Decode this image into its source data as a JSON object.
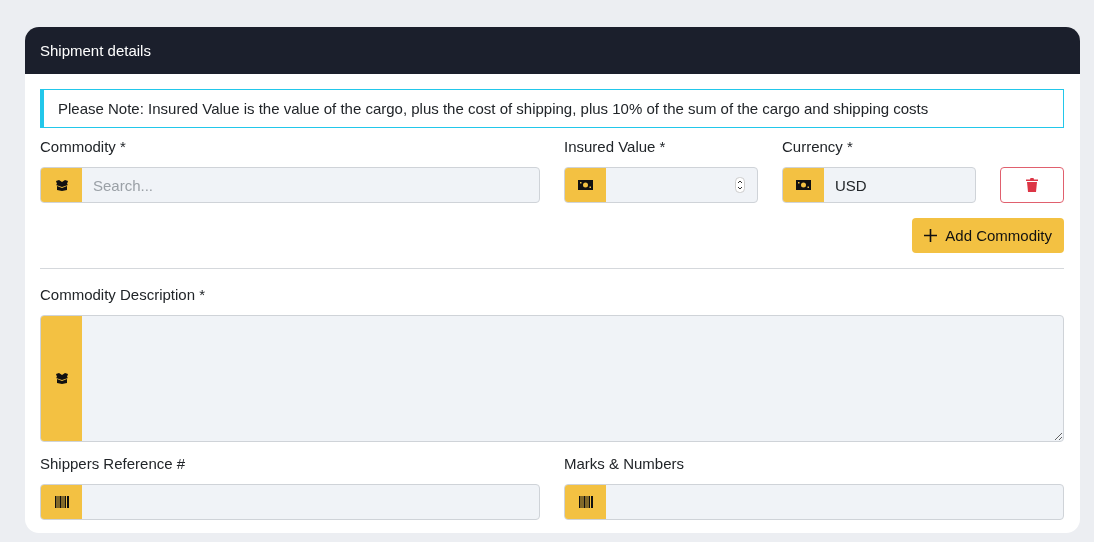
{
  "panel": {
    "title": "Shipment details"
  },
  "note": "Please Note: Insured Value is the value of the cargo, plus the cost of shipping, plus 10% of the sum of the cargo and shipping costs",
  "commodity_row": [
    {
      "label": "Commodity *",
      "kind": "search",
      "placeholder": "Search..."
    },
    {
      "label": "Insured Value *",
      "kind": "number"
    },
    {
      "label": "Currency *",
      "kind": "text",
      "value": "USD"
    }
  ],
  "add_button": {
    "label": "Add Commodity"
  },
  "description": {
    "label": "Commodity Description *",
    "kind": "textarea"
  },
  "reference_row": [
    {
      "label": "Shippers Reference #",
      "kind": "text"
    },
    {
      "label": "Marks & Numbers",
      "kind": "text"
    }
  ]
}
